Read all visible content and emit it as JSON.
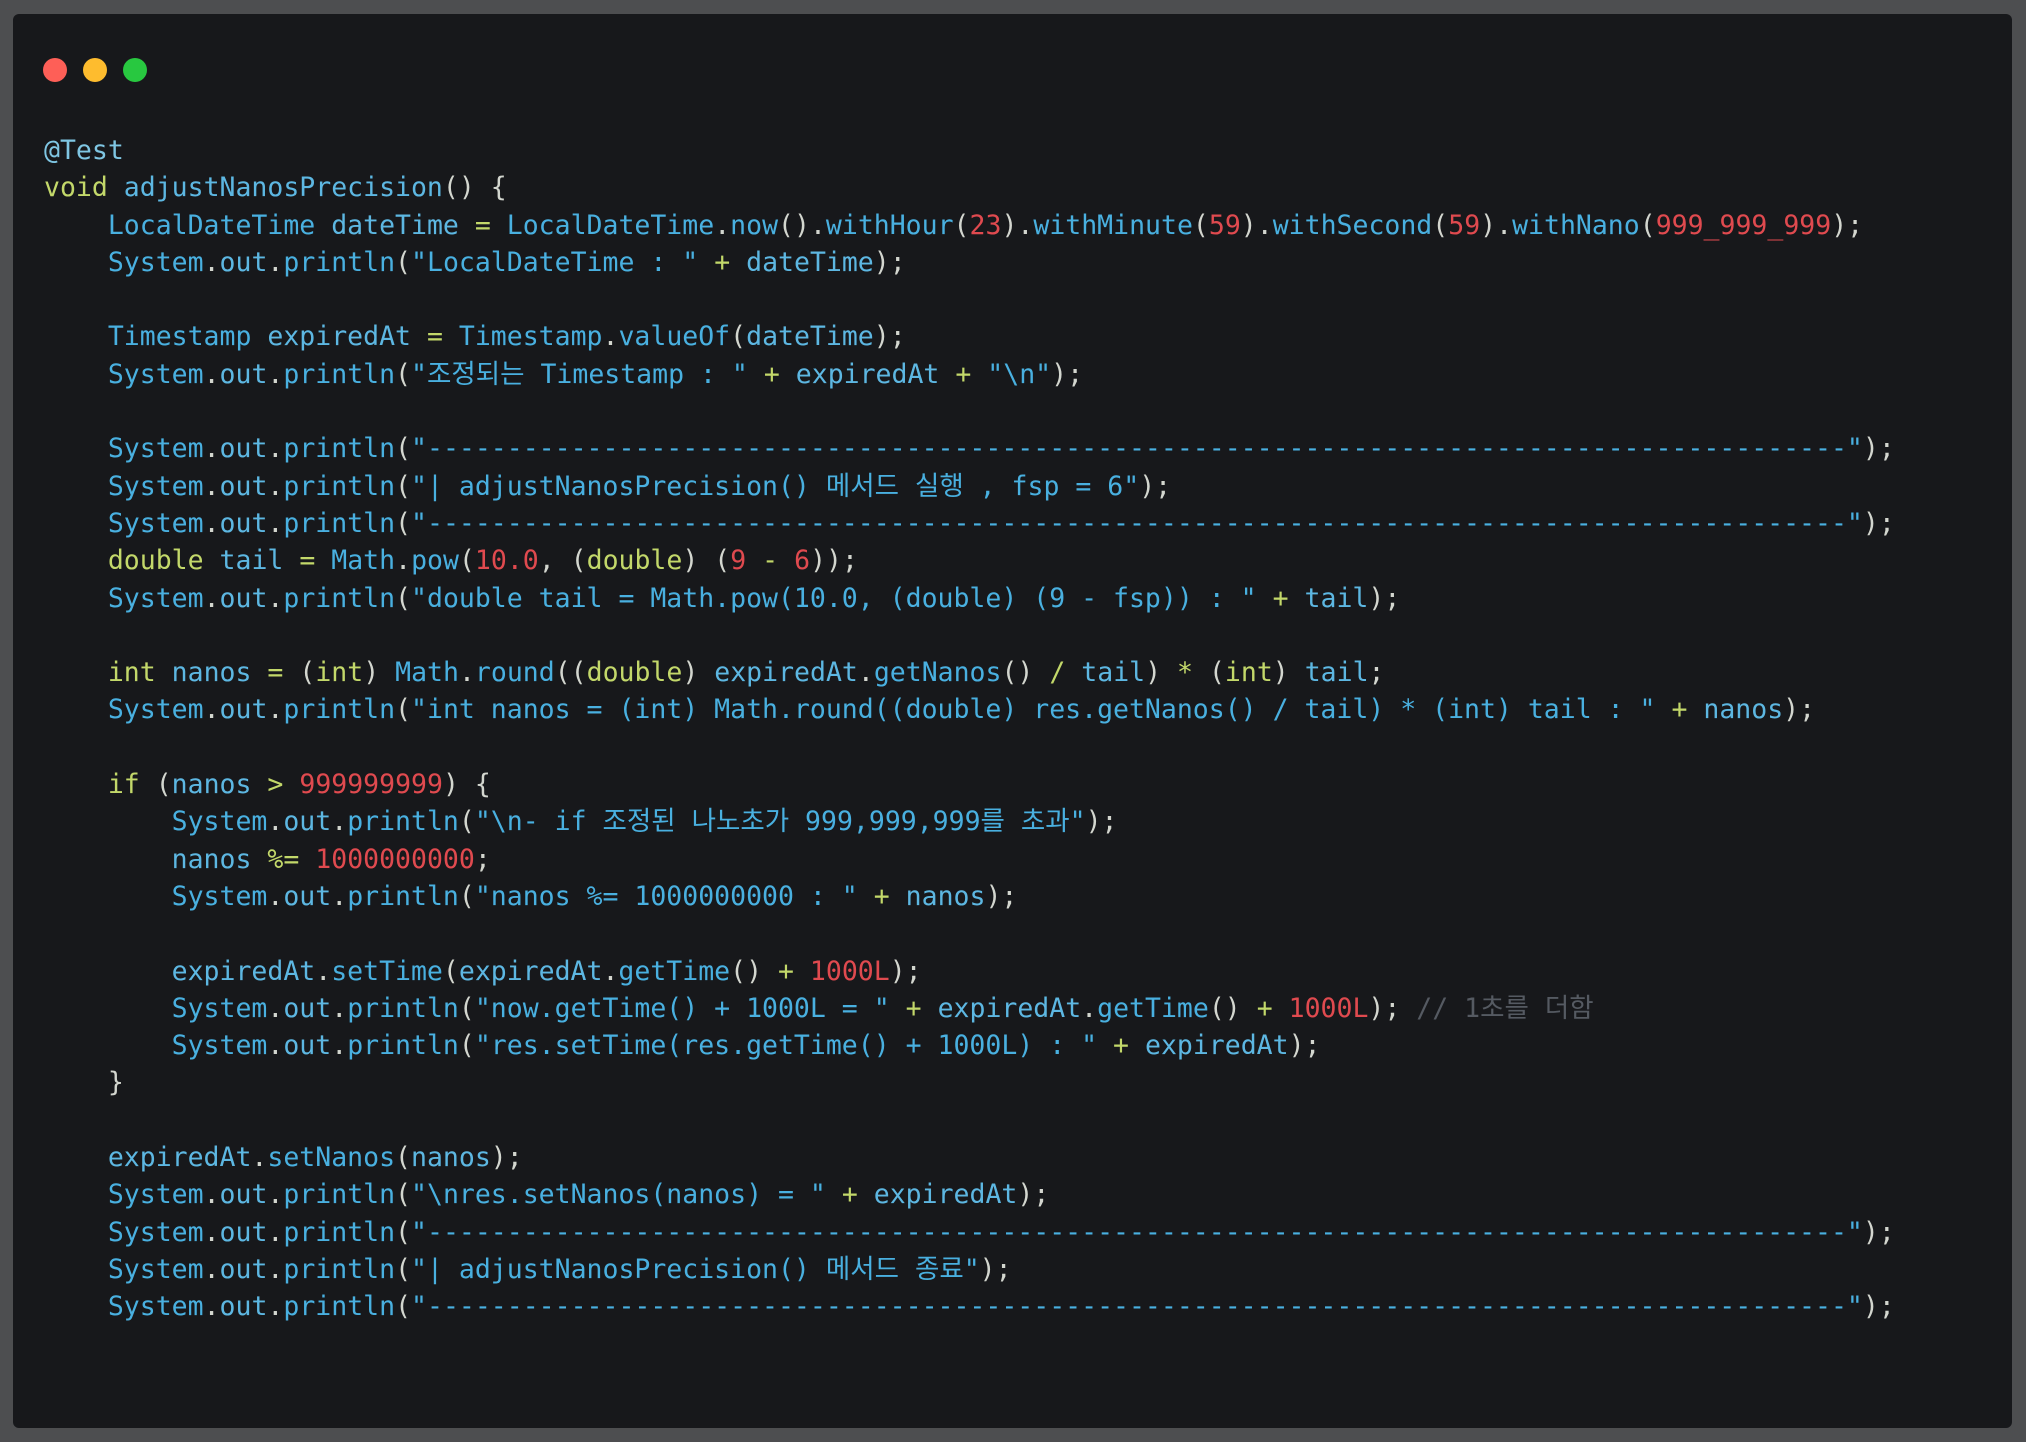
{
  "window": {
    "controls": [
      {
        "name": "close",
        "color": "#fe5f57"
      },
      {
        "name": "minimize",
        "color": "#febc2e"
      },
      {
        "name": "zoom",
        "color": "#28c840"
      }
    ]
  },
  "colors": {
    "background": "#17181b",
    "backdrop": "#4d4e50",
    "keyword": "#c3d86a",
    "identifier": "#49b0e0",
    "number": "#e04a4f",
    "punctuation": "#d3d6cf",
    "comment": "#555a62"
  },
  "code": {
    "language": "java",
    "lines": [
      [
        [
          "@Test",
          "t-annot"
        ]
      ],
      [
        [
          "void",
          "t-kw"
        ],
        [
          " ",
          "t-punc"
        ],
        [
          "adjustNanosPrecision",
          "t-ident"
        ],
        [
          "() {",
          "t-punc"
        ]
      ],
      [
        [
          "    ",
          "t-punc"
        ],
        [
          "LocalDateTime",
          "t-type"
        ],
        [
          " ",
          "t-punc"
        ],
        [
          "dateTime",
          "t-ident"
        ],
        [
          " ",
          "t-punc"
        ],
        [
          "=",
          "t-op"
        ],
        [
          " ",
          "t-punc"
        ],
        [
          "LocalDateTime",
          "t-type"
        ],
        [
          ".",
          "t-punc"
        ],
        [
          "now",
          "t-method"
        ],
        [
          "().",
          "t-punc"
        ],
        [
          "withHour",
          "t-method"
        ],
        [
          "(",
          "t-punc"
        ],
        [
          "23",
          "t-num"
        ],
        [
          ").",
          "t-punc"
        ],
        [
          "withMinute",
          "t-method"
        ],
        [
          "(",
          "t-punc"
        ],
        [
          "59",
          "t-num"
        ],
        [
          ").",
          "t-punc"
        ],
        [
          "withSecond",
          "t-method"
        ],
        [
          "(",
          "t-punc"
        ],
        [
          "59",
          "t-num"
        ],
        [
          ").",
          "t-punc"
        ],
        [
          "withNano",
          "t-method"
        ],
        [
          "(",
          "t-punc"
        ],
        [
          "999_999_999",
          "t-num"
        ],
        [
          ");",
          "t-punc"
        ]
      ],
      [
        [
          "    ",
          "t-punc"
        ],
        [
          "System",
          "t-type"
        ],
        [
          ".",
          "t-punc"
        ],
        [
          "out",
          "t-ident"
        ],
        [
          ".",
          "t-punc"
        ],
        [
          "println",
          "t-method"
        ],
        [
          "(",
          "t-punc"
        ],
        [
          "\"LocalDateTime : \"",
          "t-str"
        ],
        [
          " ",
          "t-punc"
        ],
        [
          "+",
          "t-op"
        ],
        [
          " ",
          "t-punc"
        ],
        [
          "dateTime",
          "t-ident"
        ],
        [
          ");",
          "t-punc"
        ]
      ],
      [],
      [
        [
          "    ",
          "t-punc"
        ],
        [
          "Timestamp",
          "t-type"
        ],
        [
          " ",
          "t-punc"
        ],
        [
          "expiredAt",
          "t-ident"
        ],
        [
          " ",
          "t-punc"
        ],
        [
          "=",
          "t-op"
        ],
        [
          " ",
          "t-punc"
        ],
        [
          "Timestamp",
          "t-type"
        ],
        [
          ".",
          "t-punc"
        ],
        [
          "valueOf",
          "t-method"
        ],
        [
          "(",
          "t-punc"
        ],
        [
          "dateTime",
          "t-ident"
        ],
        [
          ");",
          "t-punc"
        ]
      ],
      [
        [
          "    ",
          "t-punc"
        ],
        [
          "System",
          "t-type"
        ],
        [
          ".",
          "t-punc"
        ],
        [
          "out",
          "t-ident"
        ],
        [
          ".",
          "t-punc"
        ],
        [
          "println",
          "t-method"
        ],
        [
          "(",
          "t-punc"
        ],
        [
          "\"조정되는 Timestamp : \"",
          "t-str"
        ],
        [
          " ",
          "t-punc"
        ],
        [
          "+",
          "t-op"
        ],
        [
          " ",
          "t-punc"
        ],
        [
          "expiredAt",
          "t-ident"
        ],
        [
          " ",
          "t-punc"
        ],
        [
          "+",
          "t-op"
        ],
        [
          " ",
          "t-punc"
        ],
        [
          "\"\\n\"",
          "t-str"
        ],
        [
          ");",
          "t-punc"
        ]
      ],
      [],
      [
        [
          "    ",
          "t-punc"
        ],
        [
          "System",
          "t-type"
        ],
        [
          ".",
          "t-punc"
        ],
        [
          "out",
          "t-ident"
        ],
        [
          ".",
          "t-punc"
        ],
        [
          "println",
          "t-method"
        ],
        [
          "(",
          "t-punc"
        ],
        [
          "\"-----------------------------------------------------------------------------------------\"",
          "t-str"
        ],
        [
          ");",
          "t-punc"
        ]
      ],
      [
        [
          "    ",
          "t-punc"
        ],
        [
          "System",
          "t-type"
        ],
        [
          ".",
          "t-punc"
        ],
        [
          "out",
          "t-ident"
        ],
        [
          ".",
          "t-punc"
        ],
        [
          "println",
          "t-method"
        ],
        [
          "(",
          "t-punc"
        ],
        [
          "\"| adjustNanosPrecision() 메서드 실행 , fsp = 6\"",
          "t-str"
        ],
        [
          ");",
          "t-punc"
        ]
      ],
      [
        [
          "    ",
          "t-punc"
        ],
        [
          "System",
          "t-type"
        ],
        [
          ".",
          "t-punc"
        ],
        [
          "out",
          "t-ident"
        ],
        [
          ".",
          "t-punc"
        ],
        [
          "println",
          "t-method"
        ],
        [
          "(",
          "t-punc"
        ],
        [
          "\"-----------------------------------------------------------------------------------------\"",
          "t-str"
        ],
        [
          ");",
          "t-punc"
        ]
      ],
      [
        [
          "    ",
          "t-punc"
        ],
        [
          "double",
          "t-kw"
        ],
        [
          " ",
          "t-punc"
        ],
        [
          "tail",
          "t-ident"
        ],
        [
          " ",
          "t-punc"
        ],
        [
          "=",
          "t-op"
        ],
        [
          " ",
          "t-punc"
        ],
        [
          "Math",
          "t-type"
        ],
        [
          ".",
          "t-punc"
        ],
        [
          "pow",
          "t-method"
        ],
        [
          "(",
          "t-punc"
        ],
        [
          "10.0",
          "t-num"
        ],
        [
          ", (",
          "t-punc"
        ],
        [
          "double",
          "t-kw"
        ],
        [
          ") (",
          "t-punc"
        ],
        [
          "9",
          "t-num"
        ],
        [
          " ",
          "t-punc"
        ],
        [
          "-",
          "t-op"
        ],
        [
          " ",
          "t-punc"
        ],
        [
          "6",
          "t-num"
        ],
        [
          "));",
          "t-punc"
        ]
      ],
      [
        [
          "    ",
          "t-punc"
        ],
        [
          "System",
          "t-type"
        ],
        [
          ".",
          "t-punc"
        ],
        [
          "out",
          "t-ident"
        ],
        [
          ".",
          "t-punc"
        ],
        [
          "println",
          "t-method"
        ],
        [
          "(",
          "t-punc"
        ],
        [
          "\"double tail = Math.pow(10.0, (double) (9 - fsp)) : \"",
          "t-str"
        ],
        [
          " ",
          "t-punc"
        ],
        [
          "+",
          "t-op"
        ],
        [
          " ",
          "t-punc"
        ],
        [
          "tail",
          "t-ident"
        ],
        [
          ");",
          "t-punc"
        ]
      ],
      [],
      [
        [
          "    ",
          "t-punc"
        ],
        [
          "int",
          "t-kw"
        ],
        [
          " ",
          "t-punc"
        ],
        [
          "nanos",
          "t-ident"
        ],
        [
          " ",
          "t-punc"
        ],
        [
          "=",
          "t-op"
        ],
        [
          " (",
          "t-punc"
        ],
        [
          "int",
          "t-kw"
        ],
        [
          ") ",
          "t-punc"
        ],
        [
          "Math",
          "t-type"
        ],
        [
          ".",
          "t-punc"
        ],
        [
          "round",
          "t-method"
        ],
        [
          "((",
          "t-punc"
        ],
        [
          "double",
          "t-kw"
        ],
        [
          ") ",
          "t-punc"
        ],
        [
          "expiredAt",
          "t-ident"
        ],
        [
          ".",
          "t-punc"
        ],
        [
          "getNanos",
          "t-method"
        ],
        [
          "() ",
          "t-punc"
        ],
        [
          "/",
          "t-op"
        ],
        [
          " ",
          "t-punc"
        ],
        [
          "tail",
          "t-ident"
        ],
        [
          ") ",
          "t-punc"
        ],
        [
          "*",
          "t-op"
        ],
        [
          " (",
          "t-punc"
        ],
        [
          "int",
          "t-kw"
        ],
        [
          ") ",
          "t-punc"
        ],
        [
          "tail",
          "t-ident"
        ],
        [
          ";",
          "t-punc"
        ]
      ],
      [
        [
          "    ",
          "t-punc"
        ],
        [
          "System",
          "t-type"
        ],
        [
          ".",
          "t-punc"
        ],
        [
          "out",
          "t-ident"
        ],
        [
          ".",
          "t-punc"
        ],
        [
          "println",
          "t-method"
        ],
        [
          "(",
          "t-punc"
        ],
        [
          "\"int nanos = (int) Math.round((double) res.getNanos() / tail) * (int) tail : \"",
          "t-str"
        ],
        [
          " ",
          "t-punc"
        ],
        [
          "+",
          "t-op"
        ],
        [
          " ",
          "t-punc"
        ],
        [
          "nanos",
          "t-ident"
        ],
        [
          ");",
          "t-punc"
        ]
      ],
      [],
      [
        [
          "    ",
          "t-punc"
        ],
        [
          "if",
          "t-kw"
        ],
        [
          " (",
          "t-punc"
        ],
        [
          "nanos",
          "t-ident"
        ],
        [
          " ",
          "t-punc"
        ],
        [
          ">",
          "t-op"
        ],
        [
          " ",
          "t-punc"
        ],
        [
          "999999999",
          "t-num"
        ],
        [
          ") {",
          "t-punc"
        ]
      ],
      [
        [
          "        ",
          "t-punc"
        ],
        [
          "System",
          "t-type"
        ],
        [
          ".",
          "t-punc"
        ],
        [
          "out",
          "t-ident"
        ],
        [
          ".",
          "t-punc"
        ],
        [
          "println",
          "t-method"
        ],
        [
          "(",
          "t-punc"
        ],
        [
          "\"\\n- if 조정된 나노초가 999,999,999를 초과\"",
          "t-str"
        ],
        [
          ");",
          "t-punc"
        ]
      ],
      [
        [
          "        ",
          "t-punc"
        ],
        [
          "nanos",
          "t-ident"
        ],
        [
          " ",
          "t-punc"
        ],
        [
          "%=",
          "t-op"
        ],
        [
          " ",
          "t-punc"
        ],
        [
          "1000000000",
          "t-num"
        ],
        [
          ";",
          "t-punc"
        ]
      ],
      [
        [
          "        ",
          "t-punc"
        ],
        [
          "System",
          "t-type"
        ],
        [
          ".",
          "t-punc"
        ],
        [
          "out",
          "t-ident"
        ],
        [
          ".",
          "t-punc"
        ],
        [
          "println",
          "t-method"
        ],
        [
          "(",
          "t-punc"
        ],
        [
          "\"nanos %= 1000000000 : \"",
          "t-str"
        ],
        [
          " ",
          "t-punc"
        ],
        [
          "+",
          "t-op"
        ],
        [
          " ",
          "t-punc"
        ],
        [
          "nanos",
          "t-ident"
        ],
        [
          ");",
          "t-punc"
        ]
      ],
      [],
      [
        [
          "        ",
          "t-punc"
        ],
        [
          "expiredAt",
          "t-ident"
        ],
        [
          ".",
          "t-punc"
        ],
        [
          "setTime",
          "t-method"
        ],
        [
          "(",
          "t-punc"
        ],
        [
          "expiredAt",
          "t-ident"
        ],
        [
          ".",
          "t-punc"
        ],
        [
          "getTime",
          "t-method"
        ],
        [
          "() ",
          "t-punc"
        ],
        [
          "+",
          "t-op"
        ],
        [
          " ",
          "t-punc"
        ],
        [
          "1000L",
          "t-num"
        ],
        [
          ");",
          "t-punc"
        ]
      ],
      [
        [
          "        ",
          "t-punc"
        ],
        [
          "System",
          "t-type"
        ],
        [
          ".",
          "t-punc"
        ],
        [
          "out",
          "t-ident"
        ],
        [
          ".",
          "t-punc"
        ],
        [
          "println",
          "t-method"
        ],
        [
          "(",
          "t-punc"
        ],
        [
          "\"now.getTime() + 1000L = \"",
          "t-str"
        ],
        [
          " ",
          "t-punc"
        ],
        [
          "+",
          "t-op"
        ],
        [
          " ",
          "t-punc"
        ],
        [
          "expiredAt",
          "t-ident"
        ],
        [
          ".",
          "t-punc"
        ],
        [
          "getTime",
          "t-method"
        ],
        [
          "() ",
          "t-punc"
        ],
        [
          "+",
          "t-op"
        ],
        [
          " ",
          "t-punc"
        ],
        [
          "1000L",
          "t-num"
        ],
        [
          "); ",
          "t-punc"
        ],
        [
          "// 1초를 더함",
          "t-comment"
        ]
      ],
      [
        [
          "        ",
          "t-punc"
        ],
        [
          "System",
          "t-type"
        ],
        [
          ".",
          "t-punc"
        ],
        [
          "out",
          "t-ident"
        ],
        [
          ".",
          "t-punc"
        ],
        [
          "println",
          "t-method"
        ],
        [
          "(",
          "t-punc"
        ],
        [
          "\"res.setTime(res.getTime() + 1000L) : \"",
          "t-str"
        ],
        [
          " ",
          "t-punc"
        ],
        [
          "+",
          "t-op"
        ],
        [
          " ",
          "t-punc"
        ],
        [
          "expiredAt",
          "t-ident"
        ],
        [
          ");",
          "t-punc"
        ]
      ],
      [
        [
          "    }",
          "t-punc"
        ]
      ],
      [],
      [
        [
          "    ",
          "t-punc"
        ],
        [
          "expiredAt",
          "t-ident"
        ],
        [
          ".",
          "t-punc"
        ],
        [
          "setNanos",
          "t-method"
        ],
        [
          "(",
          "t-punc"
        ],
        [
          "nanos",
          "t-ident"
        ],
        [
          ");",
          "t-punc"
        ]
      ],
      [
        [
          "    ",
          "t-punc"
        ],
        [
          "System",
          "t-type"
        ],
        [
          ".",
          "t-punc"
        ],
        [
          "out",
          "t-ident"
        ],
        [
          ".",
          "t-punc"
        ],
        [
          "println",
          "t-method"
        ],
        [
          "(",
          "t-punc"
        ],
        [
          "\"\\nres.setNanos(nanos) = \"",
          "t-str"
        ],
        [
          " ",
          "t-punc"
        ],
        [
          "+",
          "t-op"
        ],
        [
          " ",
          "t-punc"
        ],
        [
          "expiredAt",
          "t-ident"
        ],
        [
          ");",
          "t-punc"
        ]
      ],
      [
        [
          "    ",
          "t-punc"
        ],
        [
          "System",
          "t-type"
        ],
        [
          ".",
          "t-punc"
        ],
        [
          "out",
          "t-ident"
        ],
        [
          ".",
          "t-punc"
        ],
        [
          "println",
          "t-method"
        ],
        [
          "(",
          "t-punc"
        ],
        [
          "\"-----------------------------------------------------------------------------------------\"",
          "t-str"
        ],
        [
          ");",
          "t-punc"
        ]
      ],
      [
        [
          "    ",
          "t-punc"
        ],
        [
          "System",
          "t-type"
        ],
        [
          ".",
          "t-punc"
        ],
        [
          "out",
          "t-ident"
        ],
        [
          ".",
          "t-punc"
        ],
        [
          "println",
          "t-method"
        ],
        [
          "(",
          "t-punc"
        ],
        [
          "\"| adjustNanosPrecision() 메서드 종료\"",
          "t-str"
        ],
        [
          ");",
          "t-punc"
        ]
      ],
      [
        [
          "    ",
          "t-punc"
        ],
        [
          "System",
          "t-type"
        ],
        [
          ".",
          "t-punc"
        ],
        [
          "out",
          "t-ident"
        ],
        [
          ".",
          "t-punc"
        ],
        [
          "println",
          "t-method"
        ],
        [
          "(",
          "t-punc"
        ],
        [
          "\"-----------------------------------------------------------------------------------------\"",
          "t-str"
        ],
        [
          ");",
          "t-punc"
        ]
      ]
    ]
  }
}
